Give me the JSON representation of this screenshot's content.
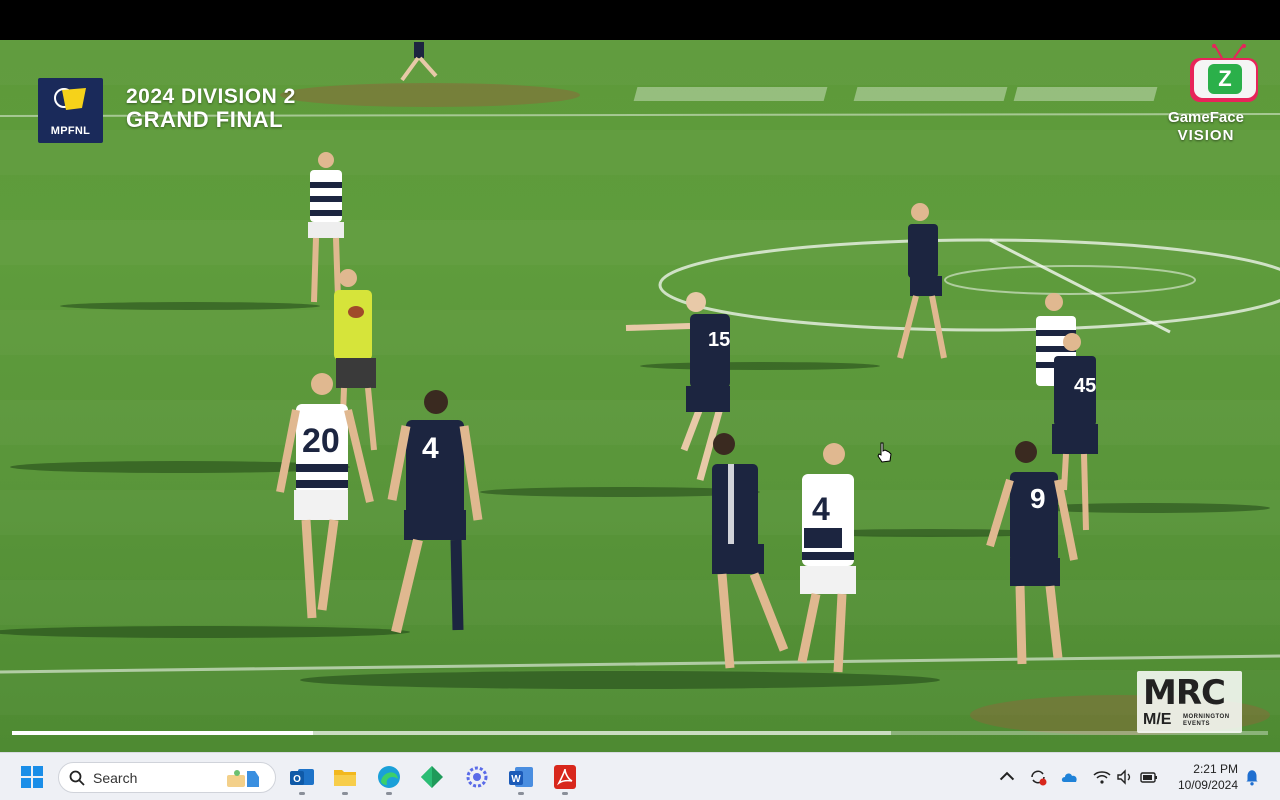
{
  "video": {
    "league_abbr": "MPFNL",
    "event_line1": "2024 DIVISION 2",
    "event_line2": "GRAND FINAL",
    "broadcaster_line1": "GameFace",
    "broadcaster_line2": "VISION",
    "producer_big": "MRC",
    "producer_me": "M/E",
    "producer_sub": "MORNINGTON EVENTS",
    "playback": {
      "played_fraction": 0.24,
      "buffered_fraction": 0.7
    },
    "players": [
      {
        "number": "20",
        "team": "hoops"
      },
      {
        "number": "4",
        "team": "navy"
      },
      {
        "number": "4",
        "team": "hoops"
      },
      {
        "number": "9",
        "team": "navy"
      },
      {
        "number": "45",
        "team": "navy"
      }
    ]
  },
  "taskbar": {
    "search_placeholder": "Search",
    "pinned": [
      "start-icon",
      "outlook-icon",
      "file-explorer-icon",
      "edge-icon",
      "app-diamond-icon",
      "app-gear-icon",
      "word-icon",
      "acrobat-icon"
    ],
    "clock_time": "2:21 PM",
    "clock_date": "10/09/2024"
  },
  "colors": {
    "grass": "#5d9a3a",
    "navy_jersey": "#1c2540",
    "taskbar_bg": "#eef0f5",
    "umpire_yellow": "#d6e43a"
  }
}
